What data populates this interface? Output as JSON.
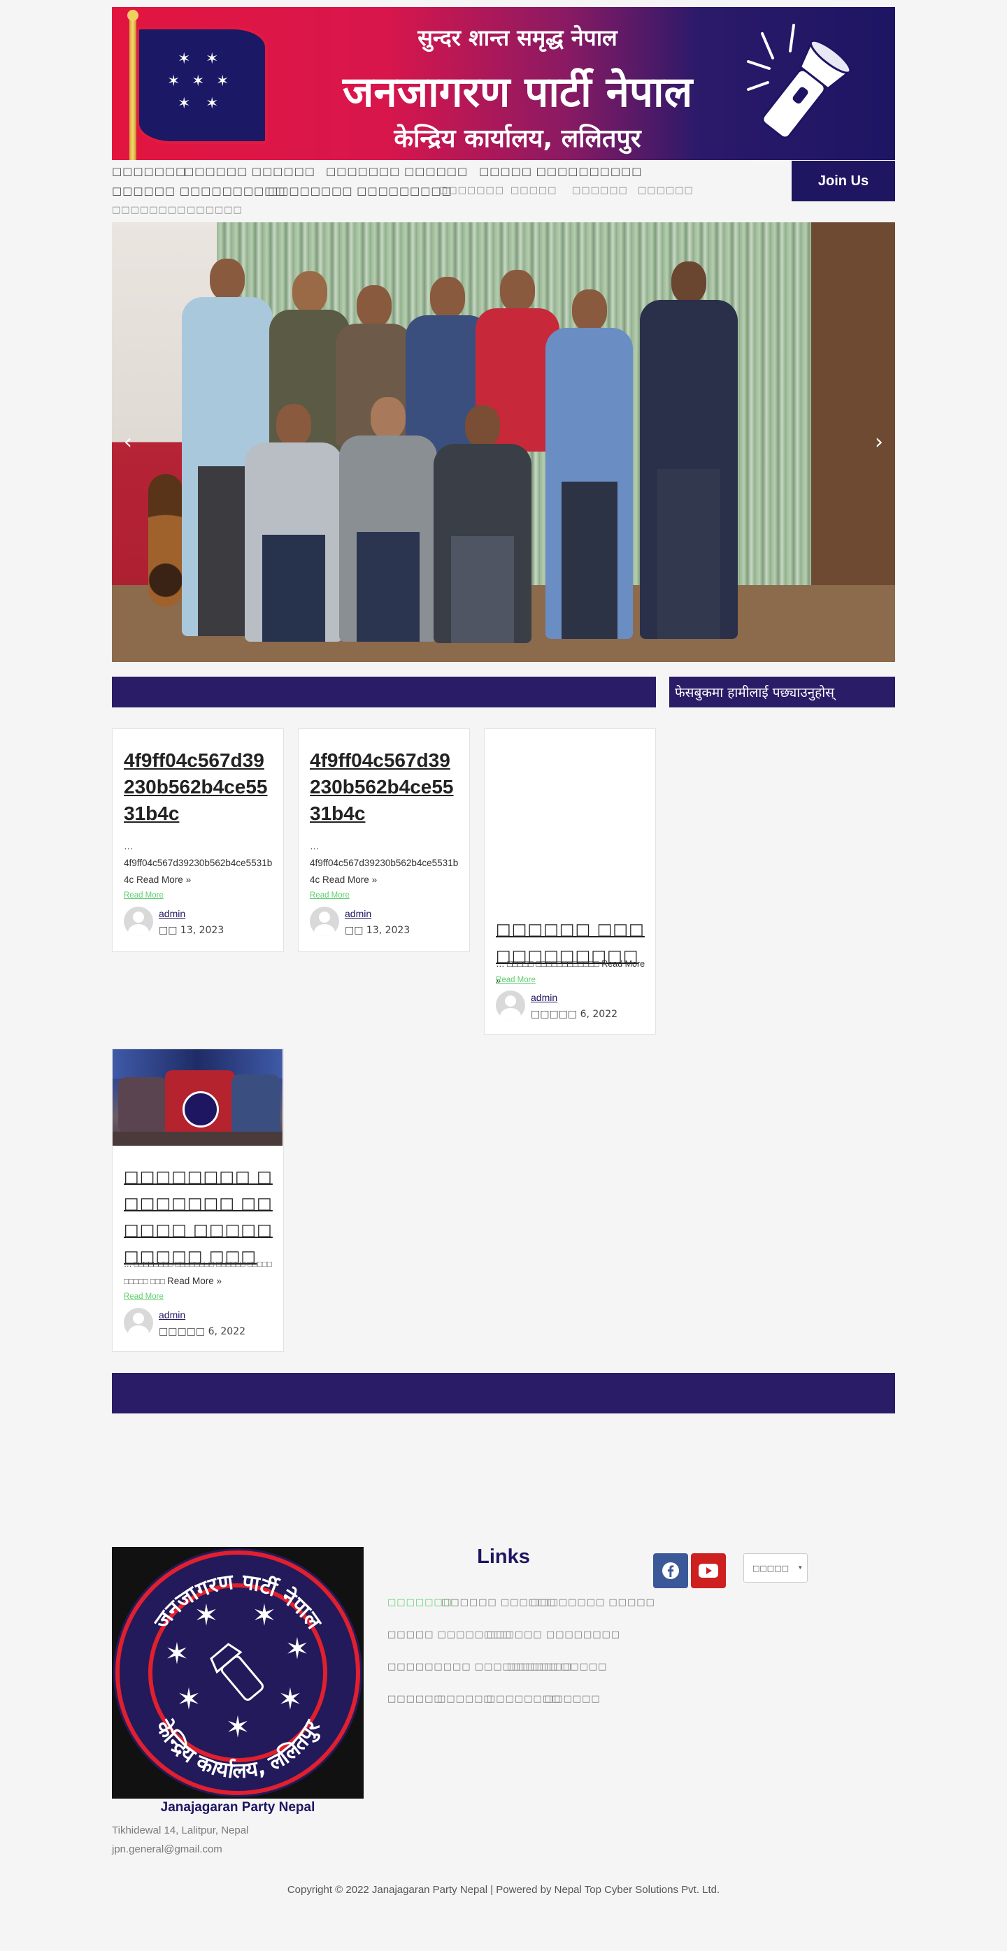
{
  "banner": {
    "slogan": "सुन्दर शान्त समृद्ध नेपाल",
    "party_name": "जनजागरण पार्टी नेपाल",
    "office": "केन्द्रिय कार्यालय, ललितपुर"
  },
  "nav": {
    "items": [
      {
        "label": "□□□□□□□"
      },
      {
        "label": "□□□□□□ □□□□□□"
      },
      {
        "label": "□□□□□□□ □□□□□□"
      },
      {
        "label": "□□□□□ □□□□□□□□□□"
      },
      {
        "label": "□□□□□□ □□□□□□□□□□"
      },
      {
        "label": "□□□□□□□□ □□□□□□□□□"
      },
      {
        "label": "□□□□□□□"
      },
      {
        "label": "□□□□□"
      },
      {
        "label": "□□□□□□"
      },
      {
        "label": "□□□□□□"
      },
      {
        "label": "□□□□□□□□"
      },
      {
        "label": "□□□□□□"
      }
    ],
    "join_label": "Join Us"
  },
  "slider": {
    "prev_icon": "chevron-left-icon",
    "next_icon": "chevron-right-icon"
  },
  "facebook_follow": "फेसबुकमा हामीलाई पछ्याउनुहोस्",
  "posts": [
    {
      "title": "4f9ff04c567d39230b562b4ce5531b4c",
      "excerpt_prefix": "…",
      "excerpt": "4f9ff04c567d39230b562b4ce5531b4c",
      "read_more_inline": "Read More »",
      "read_more": "Read More",
      "author": "admin",
      "date": "□□ 13, 2023"
    },
    {
      "title": "4f9ff04c567d39230b562b4ce5531b4c",
      "excerpt_prefix": "…",
      "excerpt": "4f9ff04c567d39230b562b4ce5531b4c",
      "read_more_inline": "Read More »",
      "read_more": "Read More",
      "author": "admin",
      "date": "□□ 13, 2023"
    },
    {
      "title": "□□□□□□ □□□□□□□□□□□□",
      "excerpt": "… □□□□□ □□□□□□□□□□□□",
      "read_more_inline": "Read More »",
      "read_more": "Read More",
      "author": "admin",
      "date": "□□□□□ 6, 2022"
    },
    {
      "title": "□□□□□□□□ □□□□□□□□ □□□□□□ □□□□□ □□□□□ □□□",
      "excerpt": "… □□□□□□□□ □□□□□□□□ □□□□□□ □□□□□ □□□□□ □□□",
      "read_more_inline": "Read More »",
      "read_more": "Read More",
      "author": "admin",
      "date": "□□□□□ 6, 2022"
    }
  ],
  "footer": {
    "logo_top_text": "जनजागरण पार्टी नेपाल",
    "logo_bottom_text": "केन्द्रिय कार्यालय, ललितपुर",
    "org_name": "Janajagaran Party Nepal",
    "address": "Tikhidewal 14, Lalitpur, Nepal",
    "email": "jpn.general@gmail.com",
    "links_title": "Links",
    "links": [
      {
        "label": "□□□□□□□"
      },
      {
        "label": "□□□□□□ □□□□□□"
      },
      {
        "label": "□□□□□□□□ □□□□□"
      },
      {
        "label": "□□□□□ □□□□□□□□"
      },
      {
        "label": "□□□□□□ □□□□□□□□"
      },
      {
        "label": "□□□□□□□□□ □□□□□□□□□"
      },
      {
        "label": "□□□□□□□"
      },
      {
        "label": "□□□□□"
      },
      {
        "label": "□□□□□□"
      },
      {
        "label": "□□□□□□"
      },
      {
        "label": "□□□□□□□□"
      },
      {
        "label": "□□□□□□"
      }
    ],
    "social": [
      {
        "icon": "facebook-icon",
        "color": "#3b5998"
      },
      {
        "icon": "youtube-icon",
        "color": "#cd201f"
      }
    ],
    "language_select": "□□□□□",
    "copyright": "Copyright © 2022 Janajagaran Party Nepal | Powered by  Nepal Top Cyber Solutions Pvt. Ltd."
  },
  "colors": {
    "brand_navy": "#1e1661",
    "section_bar": "#2a1c66",
    "accent_green": "#61ce70",
    "banner_red": "#e2153f"
  }
}
